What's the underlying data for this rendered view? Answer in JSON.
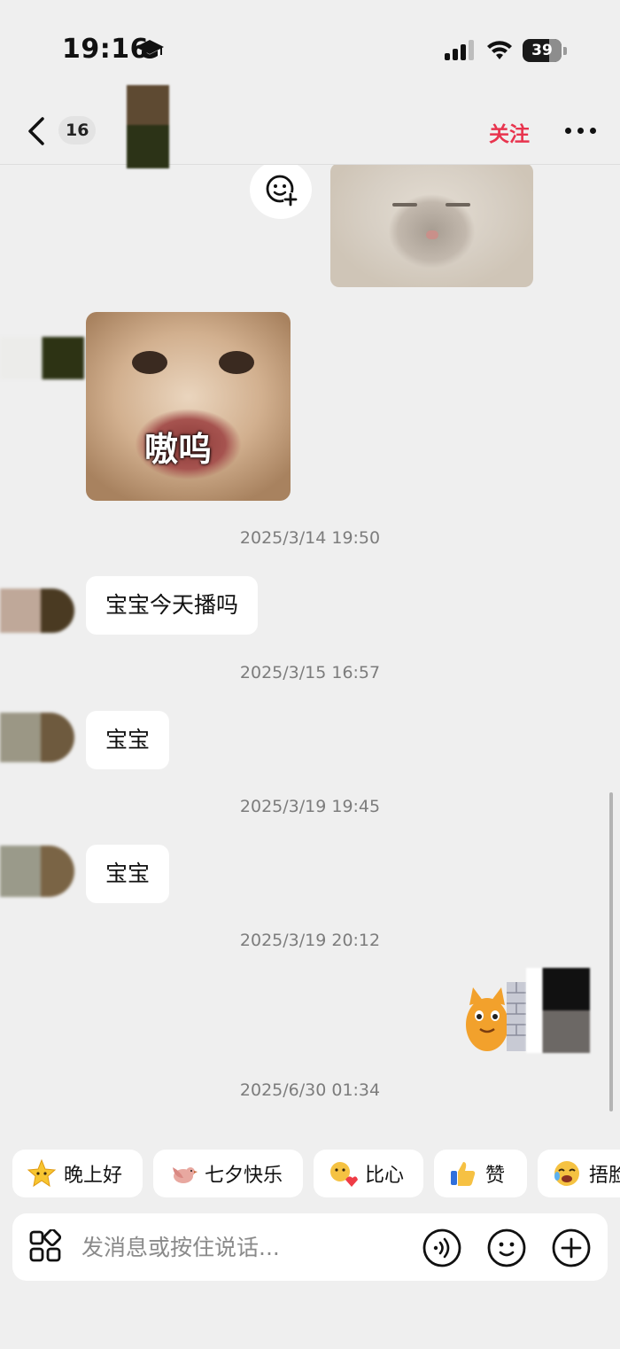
{
  "status_bar": {
    "time": "19:16",
    "battery": "39"
  },
  "nav": {
    "unread_count": "16",
    "follow_label": "关注"
  },
  "chat": {
    "sticker_caption": "嗷呜",
    "messages": [
      {
        "timestamp": "2025/3/14 19:50",
        "text": "宝宝今天播吗"
      },
      {
        "timestamp": "2025/3/15 16:57",
        "text": "宝宝"
      },
      {
        "timestamp": "2025/3/19 19:45",
        "text": "宝宝"
      }
    ],
    "my_message_timestamp": "2025/3/19 20:12",
    "last_timestamp": "2025/6/30 01:34"
  },
  "quick_replies": [
    {
      "label": "晚上好",
      "icon": "star-face-icon"
    },
    {
      "label": "七夕快乐",
      "icon": "magpie-icon"
    },
    {
      "label": "比心",
      "icon": "heart-hands-icon"
    },
    {
      "label": "赞",
      "icon": "thumbs-up-icon"
    },
    {
      "label": "捂脸",
      "icon": "facepalm-icon"
    }
  ],
  "input": {
    "placeholder": "发消息或按住说话..."
  }
}
